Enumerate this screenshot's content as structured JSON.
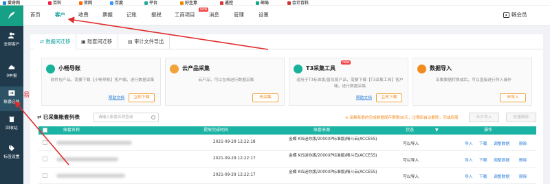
{
  "bookmarks": [
    "爱奇网",
    "百科",
    "官网",
    "百度",
    "平台",
    "好生意",
    "遥控",
    "邮局",
    "会计百科"
  ],
  "topnav": {
    "items": [
      {
        "label": "首页",
        "active": false
      },
      {
        "label": "客户",
        "active": true
      },
      {
        "label": "收费",
        "active": false
      },
      {
        "label": "票据",
        "active": false
      },
      {
        "label": "记账",
        "active": false
      },
      {
        "label": "报税",
        "active": false
      },
      {
        "label": "工商项目",
        "active": false,
        "badge": "new"
      },
      {
        "label": "消息",
        "active": false
      },
      {
        "label": "管理",
        "active": false
      },
      {
        "label": "设置",
        "active": false
      }
    ],
    "vip": "畅会员"
  },
  "sidebar": {
    "items": [
      {
        "label": "全部客户",
        "icon": "users-icon"
      },
      {
        "label": "0申报",
        "icon": "cloud-icon"
      },
      {
        "label": "账套迁移",
        "icon": "migrate-icon",
        "active": true
      },
      {
        "label": "回收站",
        "icon": "trash-icon"
      },
      {
        "label": "标签设置",
        "icon": "tag-icon"
      }
    ]
  },
  "annotation": "易代账",
  "tabs": [
    "数据间迁移",
    "账套间迁移",
    "审计文件导出"
  ],
  "cards": [
    {
      "title": "小畅导账",
      "desc": "软件包产品，需要下载【小畅导账】客户端，进行数据采集",
      "help": "帮助文档",
      "button": "立即下载",
      "color": "#16b39a"
    },
    {
      "title": "云产品采集",
      "desc": "云产品，可以在线进行数据采集",
      "help": "",
      "button": "去采集",
      "color": "#f2a33a"
    },
    {
      "title": "T3采集工具",
      "desc": "适用于T3标准版/普及版产品，需要下载【T3采集工具】客户端，进行数据采集",
      "help": "帮助文档",
      "button": "立即下载",
      "color": "#16b39a",
      "badge": "new"
    },
    {
      "title": "数据导入",
      "desc": "采集数据转换成后，可以直接进行导入操作",
      "help": "",
      "button": "去导入",
      "color": "#f28b1e"
    }
  ],
  "list": {
    "title": "已采集账套列表",
    "search_placeholder": "请输入账套名称查询",
    "warning": "⊙ 采集账套的完成数据保存期限30天，过期后自动删除，完成后需",
    "btn_merge": "合并导入",
    "btn_delete": "批量删除"
  },
  "table": {
    "headers": [
      "账套名称",
      "提取完成时间",
      "账套来源",
      "状态",
      "操作"
    ],
    "rows": [
      {
        "time": "2021-09-29 12:22:18",
        "source": "金蝶 KIS迷你版/2000XP标准版/精斗云(ACCESS)",
        "status": "可以导入"
      },
      {
        "time": "2021-09-29 12:22:17",
        "source": "金蝶 KIS迷你版/2000XP标准版/精斗云(ACCESS)",
        "status": "可以导入"
      },
      {
        "time": "2021-09-29 12:22:17",
        "source": "金蝶 KIS迷你版/2000XP标准版/精斗云(ACCESS)",
        "status": "可以导入"
      }
    ],
    "actions": [
      "导入",
      "下载",
      "调整数据",
      "删除"
    ]
  },
  "colors": {
    "brand": "#1bb3a3",
    "sidebar": "#203a4c",
    "accent": "#f28b1e",
    "link": "#2b7fd6",
    "annotation": "#e02b2b"
  }
}
